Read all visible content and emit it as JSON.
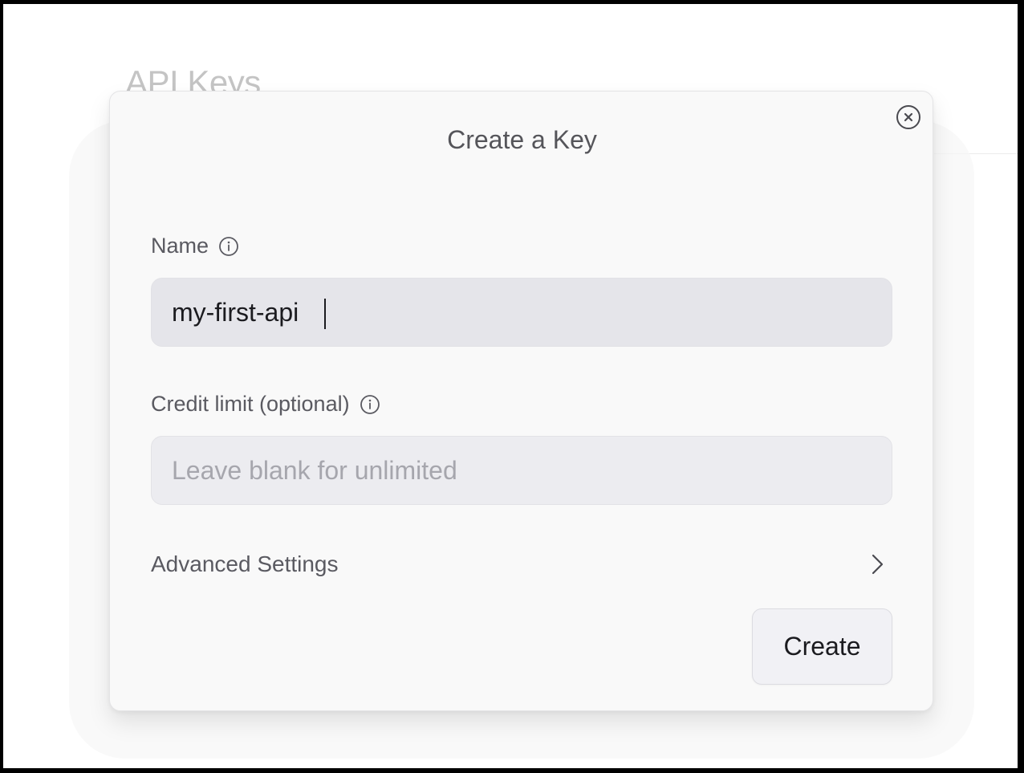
{
  "page": {
    "title": "API Keys"
  },
  "modal": {
    "title": "Create a Key",
    "close_icon": "close-circle-icon",
    "name_field": {
      "label": "Name",
      "info_icon": "info-icon",
      "value": "my-first-api"
    },
    "credit_field": {
      "label": "Credit limit (optional)",
      "info_icon": "info-icon",
      "value": "",
      "placeholder": "Leave blank for unlimited"
    },
    "advanced": {
      "label": "Advanced Settings",
      "icon": "chevron-right-icon"
    },
    "create_button": {
      "label": "Create"
    }
  },
  "colors": {
    "label_text": "#5a5a61",
    "input_bg_active": "#e5e5ea",
    "input_bg": "#ececf0",
    "modal_bg": "#f9f9f9",
    "button_bg": "#f1f1f5"
  }
}
